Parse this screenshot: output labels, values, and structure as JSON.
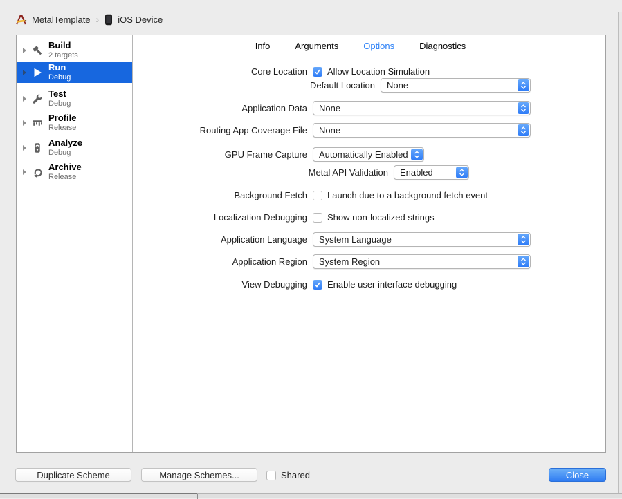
{
  "header": {
    "project_name": "MetalTemplate",
    "separator": "›",
    "device_name": "iOS Device"
  },
  "sidebar": {
    "items": [
      {
        "label": "Build",
        "sublabel": "2 targets",
        "icon": "build-hammer-icon",
        "selected": false
      },
      {
        "label": "Run",
        "sublabel": "Debug",
        "icon": "run-play-icon",
        "selected": true
      },
      {
        "label": "Test",
        "sublabel": "Debug",
        "icon": "test-wrench-icon",
        "selected": false
      },
      {
        "label": "Profile",
        "sublabel": "Release",
        "icon": "profile-caliper-icon",
        "selected": false
      },
      {
        "label": "Analyze",
        "sublabel": "Debug",
        "icon": "analyze-icon",
        "selected": false
      },
      {
        "label": "Archive",
        "sublabel": "Release",
        "icon": "archive-icon",
        "selected": false
      }
    ]
  },
  "tabs": [
    {
      "label": "Info",
      "active": false
    },
    {
      "label": "Arguments",
      "active": false
    },
    {
      "label": "Options",
      "active": true
    },
    {
      "label": "Diagnostics",
      "active": false
    }
  ],
  "form": {
    "core_location": {
      "label": "Core Location",
      "checked": true,
      "checkbox_label": "Allow Location Simulation"
    },
    "default_location": {
      "label": "Default Location",
      "value": "None"
    },
    "application_data": {
      "label": "Application Data",
      "value": "None"
    },
    "routing_app_coverage": {
      "label": "Routing App Coverage File",
      "value": "None"
    },
    "gpu_frame_capture": {
      "label": "GPU Frame Capture",
      "value": "Automatically Enabled"
    },
    "metal_api_validation": {
      "label": "Metal API Validation",
      "value": "Enabled"
    },
    "background_fetch": {
      "label": "Background Fetch",
      "checked": false,
      "checkbox_label": "Launch due to a background fetch event"
    },
    "localization_debugging": {
      "label": "Localization Debugging",
      "checked": false,
      "checkbox_label": "Show non-localized strings"
    },
    "application_language": {
      "label": "Application Language",
      "value": "System Language"
    },
    "application_region": {
      "label": "Application Region",
      "value": "System Region"
    },
    "view_debugging": {
      "label": "View Debugging",
      "checked": true,
      "checkbox_label": "Enable user interface debugging"
    }
  },
  "footer": {
    "duplicate_label": "Duplicate Scheme",
    "manage_label": "Manage Schemes...",
    "shared_label": "Shared",
    "shared_checked": false,
    "close_label": "Close"
  },
  "colors": {
    "selection_blue": "#1767df",
    "control_blue": "#2d7bf7",
    "tab_active_blue": "#2e82f7",
    "sheet_background": "#ececec"
  }
}
